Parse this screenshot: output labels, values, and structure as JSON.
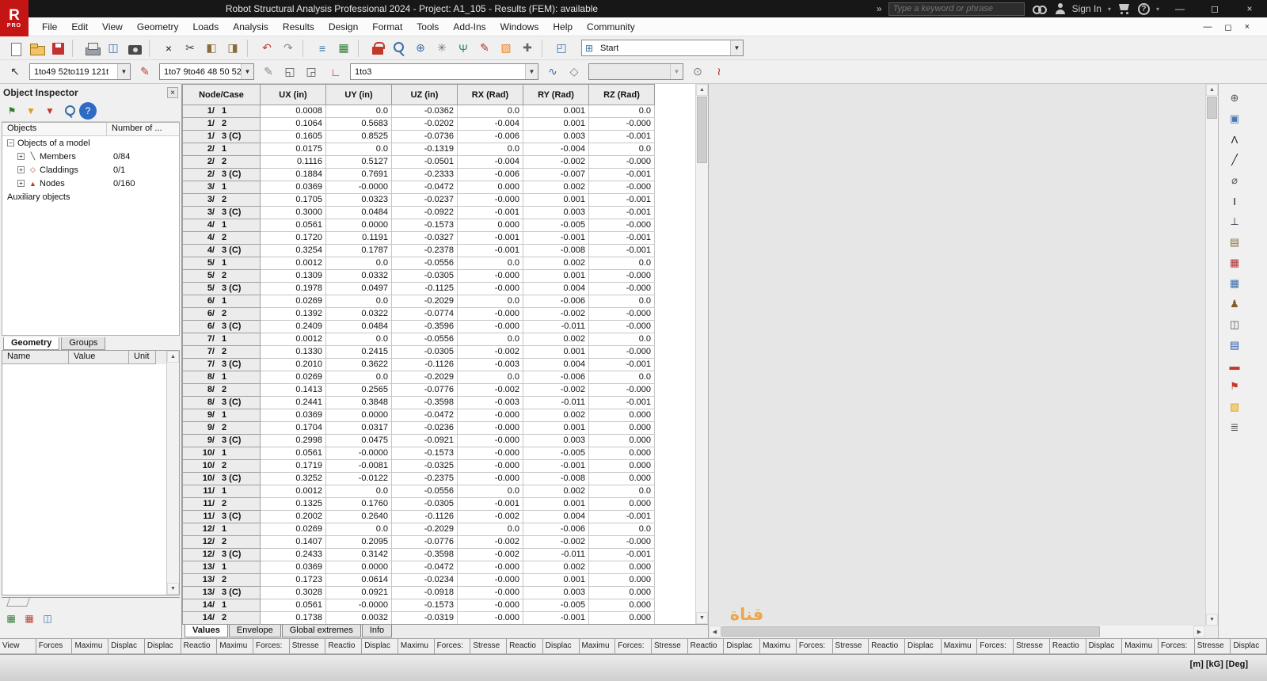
{
  "title_bar": {
    "title": "Robot Structural Analysis Professional 2024 - Project: A1_105 - Results (FEM): available",
    "logo_top": "R",
    "logo_bottom": "PRO",
    "search_placeholder": "Type a keyword or phrase",
    "sign_in_label": "Sign In"
  },
  "menu": {
    "items": [
      "File",
      "Edit",
      "View",
      "Geometry",
      "Loads",
      "Analysis",
      "Results",
      "Design",
      "Format",
      "Tools",
      "Add-Ins",
      "Windows",
      "Help",
      "Community"
    ]
  },
  "toolbar1": {
    "layout_label": "Start",
    "icons": [
      {
        "name": "new-document-icon",
        "cls": "ic-page"
      },
      {
        "name": "open-icon",
        "cls": "ic-folder"
      },
      {
        "name": "save-icon",
        "cls": "ic-floppy"
      },
      {
        "sep": true
      },
      {
        "name": "print-icon",
        "cls": "ic-printer"
      },
      {
        "name": "print-preview-icon",
        "glyph": "◫",
        "fg": "#3a6ea5"
      },
      {
        "name": "screen-capture-icon",
        "cls": "ic-camera"
      },
      {
        "sep": true
      },
      {
        "name": "delete-icon",
        "glyph": "×",
        "fg": "#1a1a1a"
      },
      {
        "name": "cut-icon",
        "glyph": "✂",
        "fg": "#444444"
      },
      {
        "name": "copy-icon",
        "glyph": "◧",
        "fg": "#8a6d3b"
      },
      {
        "name": "paste-icon",
        "glyph": "◨",
        "fg": "#8a6d3b"
      },
      {
        "sep": true
      },
      {
        "name": "undo-icon",
        "glyph": "↶",
        "fg": "#c0392b"
      },
      {
        "name": "redo-icon",
        "glyph": "↷",
        "fg": "#888888"
      },
      {
        "sep": true
      },
      {
        "name": "numbering-icon",
        "glyph": "≡",
        "fg": "#3a6ea5"
      },
      {
        "name": "calculations-table-icon",
        "glyph": "▦",
        "fg": "#2e7d32"
      },
      {
        "sep": true
      },
      {
        "name": "lock-results-icon",
        "cls": "ic-lock"
      },
      {
        "name": "zoom-icon",
        "cls": "mag"
      },
      {
        "name": "zoom-world-icon",
        "glyph": "⊕",
        "fg": "#3a6ea5"
      },
      {
        "name": "gear-icon",
        "glyph": "✳",
        "fg": "#777777"
      },
      {
        "name": "analysis-branch-icon",
        "glyph": "Ψ",
        "fg": "#2e8b57"
      },
      {
        "name": "design-pencil-icon",
        "glyph": "✎",
        "fg": "#b03030"
      },
      {
        "name": "cube-3d-icon",
        "glyph": "▧",
        "fg": "#e67e22"
      },
      {
        "name": "tools-icon",
        "glyph": "✚",
        "fg": "#666666"
      },
      {
        "sep": true
      },
      {
        "name": "view-manager-icon",
        "glyph": "◰",
        "fg": "#3a6ea5"
      }
    ]
  },
  "toolbar2": {
    "node_selection": "1to49 52to119 121t",
    "member_selection": "1to7 9to46 48 50 52",
    "case_selection": "1to3",
    "icons_select": [
      {
        "name": "selection-pointer-icon",
        "glyph": "↖",
        "fg": "#333333"
      }
    ],
    "icons_a": [
      {
        "name": "edit-node-selection-icon",
        "glyph": "✎",
        "fg": "#c0392b"
      }
    ],
    "icons_b": [
      {
        "name": "edit-member-selection-icon",
        "glyph": "✎",
        "fg": "#888888"
      },
      {
        "name": "window-display-icon",
        "glyph": "◱",
        "fg": "#555555"
      },
      {
        "name": "window-display2-icon",
        "glyph": "◲",
        "fg": "#555555"
      }
    ],
    "icons_c": [
      {
        "name": "axis-ruler-icon",
        "glyph": "∟",
        "fg": "#b03030"
      }
    ],
    "icons_d": [
      {
        "name": "mode-curve-icon",
        "glyph": "∿",
        "fg": "#3a6ea5"
      },
      {
        "name": "components-icon",
        "glyph": "◇",
        "fg": "#777777"
      }
    ],
    "icons_e": [
      {
        "name": "disk-ellipse-icon",
        "glyph": "⊙",
        "fg": "#777777"
      },
      {
        "name": "spline-icon",
        "glyph": "≀",
        "fg": "#b03030"
      }
    ]
  },
  "inspector": {
    "title": "Object Inspector",
    "toolbar_icons": [
      {
        "name": "bookmark-flag-icon",
        "glyph": "⚑",
        "fg": "#2e7d32"
      },
      {
        "name": "filter-icon",
        "glyph": "▼",
        "fg": "#d8a018"
      },
      {
        "name": "filter-clear-icon",
        "glyph": "▼",
        "fg": "#c0392b"
      },
      {
        "name": "search-icon",
        "cls": "mag"
      },
      {
        "name": "help-icon",
        "glyph": "?",
        "fg": "#ffffff",
        "bg": "#2f6bc4",
        "round": true
      }
    ],
    "columns": [
      "Objects",
      "Number of ..."
    ],
    "tree": [
      {
        "label": "Objects of a model",
        "count": "",
        "expander": "−",
        "glyph": "",
        "level": 0
      },
      {
        "label": "Members",
        "count": "0/84",
        "expander": "+",
        "glyph": "╲",
        "glyph_color": "#222222",
        "level": 1
      },
      {
        "label": "Claddings",
        "count": "0/1",
        "expander": "+",
        "glyph": "◇",
        "glyph_color": "#c0392b",
        "level": 1
      },
      {
        "label": "Nodes",
        "count": "0/160",
        "expander": "+",
        "glyph": "▲",
        "glyph_color": "#c0392b",
        "level": 1
      },
      {
        "label": "Auxiliary objects",
        "count": "",
        "expander": "",
        "glyph": "",
        "level": 0
      }
    ],
    "tabs": [
      "Geometry",
      "Groups"
    ],
    "grid_columns": [
      "Name",
      "Value",
      "Unit"
    ],
    "bottom_icons": [
      {
        "name": "tables-icon",
        "glyph": "▦",
        "fg": "#2e7d32"
      },
      {
        "name": "edit-table-icon",
        "glyph": "▦",
        "fg": "#c0392b"
      },
      {
        "name": "print-layout-icon",
        "glyph": "◫",
        "fg": "#3a6ea5"
      }
    ]
  },
  "results_table": {
    "columns": [
      "Node/Case",
      "UX (in)",
      "UY (in)",
      "UZ (in)",
      "RX (Rad)",
      "RY (Rad)",
      "RZ (Rad)"
    ],
    "tabs": [
      "Values",
      "Envelope",
      "Global extremes",
      "Info"
    ],
    "rows": [
      [
        "1/ 1",
        "0.0008",
        "0.0",
        "-0.0362",
        "0.0",
        "0.001",
        "0.0"
      ],
      [
        "1/ 2",
        "0.1064",
        "0.5683",
        "-0.0202",
        "-0.004",
        "0.001",
        "-0.000"
      ],
      [
        "1/ 3 (C)",
        "0.1605",
        "0.8525",
        "-0.0736",
        "-0.006",
        "0.003",
        "-0.001"
      ],
      [
        "2/ 1",
        "0.0175",
        "0.0",
        "-0.1319",
        "0.0",
        "-0.004",
        "0.0"
      ],
      [
        "2/ 2",
        "0.1116",
        "0.5127",
        "-0.0501",
        "-0.004",
        "-0.002",
        "-0.000"
      ],
      [
        "2/ 3 (C)",
        "0.1884",
        "0.7691",
        "-0.2333",
        "-0.006",
        "-0.007",
        "-0.001"
      ],
      [
        "3/ 1",
        "0.0369",
        "-0.0000",
        "-0.0472",
        "0.000",
        "0.002",
        "-0.000"
      ],
      [
        "3/ 2",
        "0.1705",
        "0.0323",
        "-0.0237",
        "-0.000",
        "0.001",
        "-0.001"
      ],
      [
        "3/ 3 (C)",
        "0.3000",
        "0.0484",
        "-0.0922",
        "-0.001",
        "0.003",
        "-0.001"
      ],
      [
        "4/ 1",
        "0.0561",
        "0.0000",
        "-0.1573",
        "0.000",
        "-0.005",
        "-0.000"
      ],
      [
        "4/ 2",
        "0.1720",
        "0.1191",
        "-0.0327",
        "-0.001",
        "-0.001",
        "-0.001"
      ],
      [
        "4/ 3 (C)",
        "0.3254",
        "0.1787",
        "-0.2378",
        "-0.001",
        "-0.008",
        "-0.001"
      ],
      [
        "5/ 1",
        "0.0012",
        "0.0",
        "-0.0556",
        "0.0",
        "0.002",
        "0.0"
      ],
      [
        "5/ 2",
        "0.1309",
        "0.0332",
        "-0.0305",
        "-0.000",
        "0.001",
        "-0.000"
      ],
      [
        "5/ 3 (C)",
        "0.1978",
        "0.0497",
        "-0.1125",
        "-0.000",
        "0.004",
        "-0.000"
      ],
      [
        "6/ 1",
        "0.0269",
        "0.0",
        "-0.2029",
        "0.0",
        "-0.006",
        "0.0"
      ],
      [
        "6/ 2",
        "0.1392",
        "0.0322",
        "-0.0774",
        "-0.000",
        "-0.002",
        "-0.000"
      ],
      [
        "6/ 3 (C)",
        "0.2409",
        "0.0484",
        "-0.3596",
        "-0.000",
        "-0.011",
        "-0.000"
      ],
      [
        "7/ 1",
        "0.0012",
        "0.0",
        "-0.0556",
        "0.0",
        "0.002",
        "0.0"
      ],
      [
        "7/ 2",
        "0.1330",
        "0.2415",
        "-0.0305",
        "-0.002",
        "0.001",
        "-0.000"
      ],
      [
        "7/ 3 (C)",
        "0.2010",
        "0.3622",
        "-0.1126",
        "-0.003",
        "0.004",
        "-0.001"
      ],
      [
        "8/ 1",
        "0.0269",
        "0.0",
        "-0.2029",
        "0.0",
        "-0.006",
        "0.0"
      ],
      [
        "8/ 2",
        "0.1413",
        "0.2565",
        "-0.0776",
        "-0.002",
        "-0.002",
        "-0.000"
      ],
      [
        "8/ 3 (C)",
        "0.2441",
        "0.3848",
        "-0.3598",
        "-0.003",
        "-0.011",
        "-0.001"
      ],
      [
        "9/ 1",
        "0.0369",
        "0.0000",
        "-0.0472",
        "-0.000",
        "0.002",
        "0.000"
      ],
      [
        "9/ 2",
        "0.1704",
        "0.0317",
        "-0.0236",
        "-0.000",
        "0.001",
        "0.000"
      ],
      [
        "9/ 3 (C)",
        "0.2998",
        "0.0475",
        "-0.0921",
        "-0.000",
        "0.003",
        "0.000"
      ],
      [
        "10/ 1",
        "0.0561",
        "-0.0000",
        "-0.1573",
        "-0.000",
        "-0.005",
        "0.000"
      ],
      [
        "10/ 2",
        "0.1719",
        "-0.0081",
        "-0.0325",
        "-0.000",
        "-0.001",
        "0.000"
      ],
      [
        "10/ 3 (C)",
        "0.3252",
        "-0.0122",
        "-0.2375",
        "-0.000",
        "-0.008",
        "0.000"
      ],
      [
        "11/ 1",
        "0.0012",
        "0.0",
        "-0.0556",
        "0.0",
        "0.002",
        "0.0"
      ],
      [
        "11/ 2",
        "0.1325",
        "0.1760",
        "-0.0305",
        "-0.001",
        "0.001",
        "0.000"
      ],
      [
        "11/ 3 (C)",
        "0.2002",
        "0.2640",
        "-0.1126",
        "-0.002",
        "0.004",
        "-0.001"
      ],
      [
        "12/ 1",
        "0.0269",
        "0.0",
        "-0.2029",
        "0.0",
        "-0.006",
        "0.0"
      ],
      [
        "12/ 2",
        "0.1407",
        "0.2095",
        "-0.0776",
        "-0.002",
        "-0.002",
        "-0.000"
      ],
      [
        "12/ 3 (C)",
        "0.2433",
        "0.3142",
        "-0.3598",
        "-0.002",
        "-0.011",
        "-0.001"
      ],
      [
        "13/ 1",
        "0.0369",
        "0.0000",
        "-0.0472",
        "-0.000",
        "0.002",
        "0.000"
      ],
      [
        "13/ 2",
        "0.1723",
        "0.0614",
        "-0.0234",
        "-0.000",
        "0.001",
        "0.000"
      ],
      [
        "13/ 3 (C)",
        "0.3028",
        "0.0921",
        "-0.0918",
        "-0.000",
        "0.003",
        "0.000"
      ],
      [
        "14/ 1",
        "0.0561",
        "-0.0000",
        "-0.1573",
        "-0.000",
        "-0.005",
        "0.000"
      ],
      [
        "14/ 2",
        "0.1738",
        "0.0032",
        "-0.0319",
        "-0.000",
        "-0.001",
        "0.000"
      ]
    ]
  },
  "right_toolbar": {
    "icons": [
      {
        "name": "pointer-target-icon",
        "glyph": "⊕",
        "fg": "#555555"
      },
      {
        "name": "view-cube-icon",
        "glyph": "▣",
        "fg": "#4a78b0"
      },
      {
        "name": "axes-icon",
        "glyph": "Λ",
        "fg": "#222222"
      },
      {
        "name": "line-draw-icon",
        "glyph": "╱",
        "fg": "#222222"
      },
      {
        "name": "section-icon",
        "glyph": "⌀",
        "fg": "#555555"
      },
      {
        "name": "i-section-icon",
        "glyph": "I",
        "fg": "#111111"
      },
      {
        "name": "support-icon",
        "glyph": "⊥",
        "fg": "#333333"
      },
      {
        "name": "panel-icon",
        "glyph": "▤",
        "fg": "#8a6d3b"
      },
      {
        "name": "building-icon",
        "glyph": "▦",
        "fg": "#b03030"
      },
      {
        "name": "grid-table-icon",
        "glyph": "▦",
        "fg": "#3a6ea5"
      },
      {
        "name": "load-person-icon",
        "glyph": "♟",
        "fg": "#8a5a2b"
      },
      {
        "name": "frames-icon",
        "glyph": "◫",
        "fg": "#555555"
      },
      {
        "name": "results-table-icon",
        "glyph": "▤",
        "fg": "#2255aa"
      },
      {
        "name": "beam-icon",
        "glyph": "▬",
        "fg": "#c0392b"
      },
      {
        "name": "flag-icon",
        "glyph": "⚑",
        "fg": "#c0392b"
      },
      {
        "name": "solid-box-icon",
        "glyph": "▧",
        "fg": "#d8a018"
      },
      {
        "name": "layers-icon",
        "glyph": "≣",
        "fg": "#555555"
      }
    ]
  },
  "bottom_tabs": [
    "View",
    "Forces",
    "Maximu",
    "Displac",
    "Displac",
    "Reactio",
    "Maximu",
    "Forces:",
    "Stresse",
    "Reactio",
    "Displac",
    "Maximu",
    "Forces:",
    "Stresse",
    "Reactio",
    "Displac",
    "Maximu",
    "Forces:",
    "Stresse",
    "Reactio",
    "Displac",
    "Maximu",
    "Forces:",
    "Stresse",
    "Reactio",
    "Displac",
    "Maximu",
    "Forces:",
    "Stresse",
    "Reactio",
    "Displac",
    "Maximu",
    "Forces:",
    "Stresse",
    "Displac"
  ],
  "status_bar": {
    "units": "[m] [kG] [Deg]"
  },
  "watermark": "قناة"
}
